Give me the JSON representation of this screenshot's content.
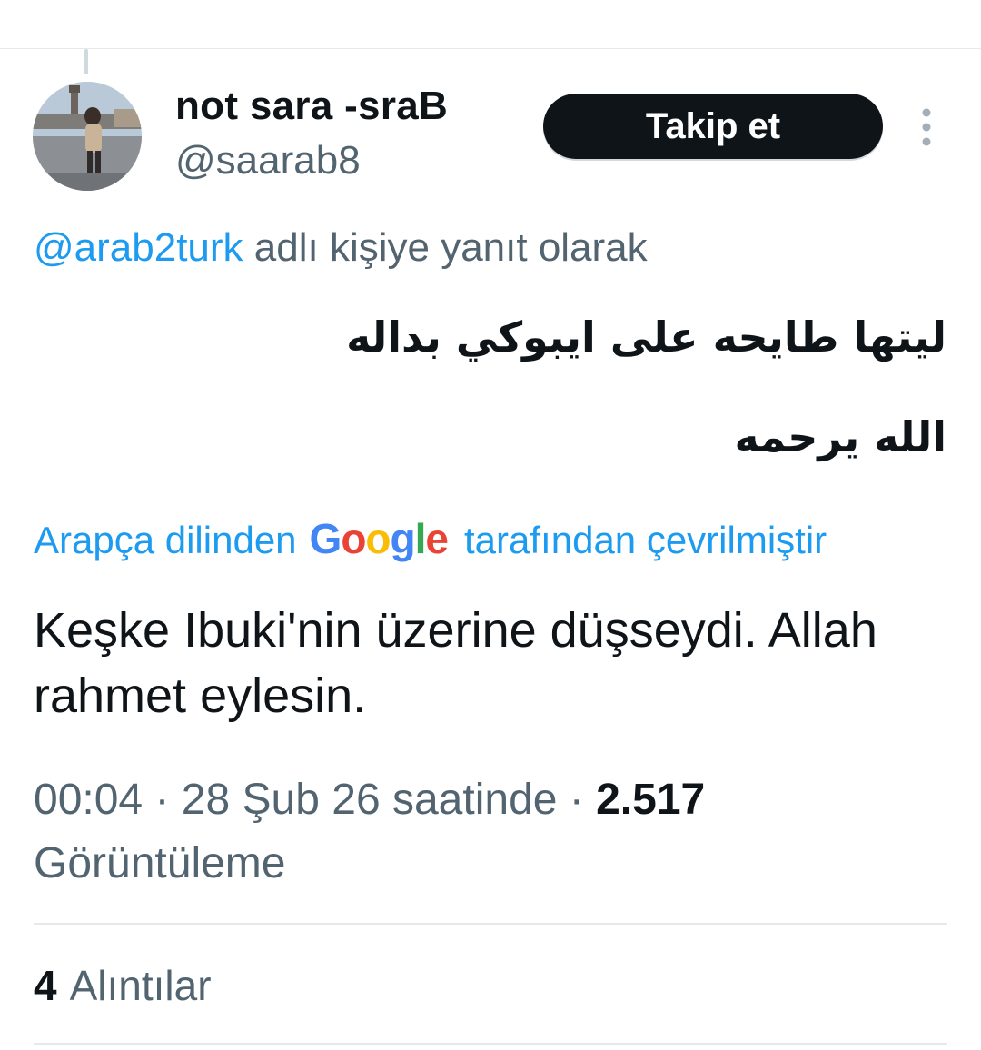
{
  "tweet": {
    "author": {
      "display_name": "not sara -sraB",
      "handle": "@saarab8"
    },
    "follow_label": "Takip et",
    "more_icon": "more-vertical-icon",
    "reply_to": {
      "mention": "@arab2turk",
      "suffix": " adlı kişiye yanıt olarak"
    },
    "original_text": {
      "line1": "ليتها طايحه على ايبوكي بداله",
      "line2": "الله يرحمه"
    },
    "translation_notice": {
      "prefix": "Arapça dilinden",
      "provider_letters": [
        "G",
        "o",
        "o",
        "g",
        "l",
        "e"
      ],
      "suffix": "tarafından çevrilmiştir"
    },
    "translated_text": "Keşke Ibuki'nin üzerine düşseydi. Allah rahmet eylesin.",
    "meta": {
      "time": "00:04",
      "separator": " · ",
      "date": "28 Şub 26 saatinde",
      "views_count": "2.517",
      "views_label": "Görüntüleme"
    },
    "quotes": {
      "count": "4",
      "label": "Alıntılar"
    }
  },
  "colors": {
    "text_primary": "#0f1419",
    "text_secondary": "#536471",
    "link": "#1d9bf0",
    "button_bg": "#0f1419",
    "divider": "#e6e9ec"
  }
}
